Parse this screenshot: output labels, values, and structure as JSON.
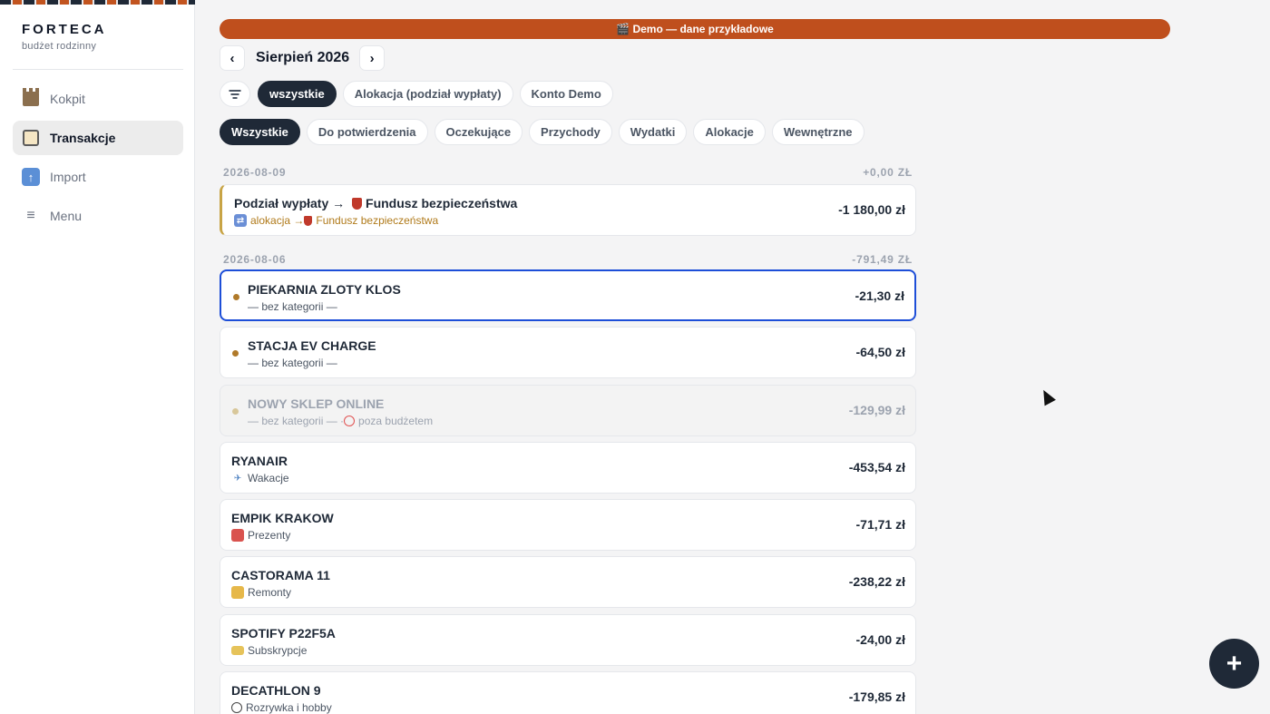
{
  "sidebar": {
    "brand": "FORTECA",
    "subtitle": "budżet rodzinny",
    "items": [
      {
        "label": "Kokpit",
        "icon": "castle-icon"
      },
      {
        "label": "Transakcje",
        "icon": "notepad-icon"
      },
      {
        "label": "Import",
        "icon": "upload-icon"
      },
      {
        "label": "Menu",
        "icon": "menu-icon"
      }
    ]
  },
  "banner": "🎬 Demo — dane przykładowe",
  "month": {
    "label": "Sierpień 2026",
    "prev": "‹",
    "next": "›"
  },
  "account_filters": [
    "wszystkie",
    "Alokacja (podział wypłaty)",
    "Konto Demo"
  ],
  "type_filters": [
    "Wszystkie",
    "Do potwierdzenia",
    "Oczekujące",
    "Przychody",
    "Wydatki",
    "Alokacje",
    "Wewnętrzne"
  ],
  "groups": [
    {
      "date": "2026-08-09",
      "total": "+0,00 ZŁ",
      "transactions": [
        {
          "name_before": "Podział wypłaty → ",
          "name_after": "Fundusz bezpieczeństwa",
          "sub_label": "alokacja → ",
          "sub_after": "Fundusz bezpieczeństwa",
          "amount": "-1 180,00 zł"
        }
      ]
    },
    {
      "date": "2026-08-06",
      "total": "-791,49 ZŁ",
      "transactions": [
        {
          "name": "PIEKARNIA ZLOTY KLOS",
          "category": "— bez kategorii —",
          "amount": "-21,30 zł"
        },
        {
          "name": "STACJA EV CHARGE",
          "category": "— bez kategorii —",
          "amount": "-64,50 zł"
        },
        {
          "name": "NOWY SKLEP ONLINE",
          "category": "— bez kategorii — · ",
          "extra": "poza budżetem",
          "amount": "-129,99 zł"
        },
        {
          "name": "RYANAIR",
          "category": "Wakacje",
          "amount": "-453,54 zł"
        },
        {
          "name": "EMPIK KRAKOW",
          "category": "Prezenty",
          "amount": "-71,71 zł"
        },
        {
          "name": "CASTORAMA 11",
          "category": "Remonty",
          "amount": "-238,22 zł"
        },
        {
          "name": "SPOTIFY P22F5A",
          "category": "Subskrypcje",
          "amount": "-24,00 zł"
        },
        {
          "name": "DECATHLON 9",
          "category": "Rozrywka i hobby",
          "amount": "-179,85 zł"
        }
      ]
    }
  ],
  "fab": "+",
  "colors": {
    "accent": "#bf4f1d",
    "dark": "#1f2937",
    "selected_border": "#1d4ed8"
  }
}
